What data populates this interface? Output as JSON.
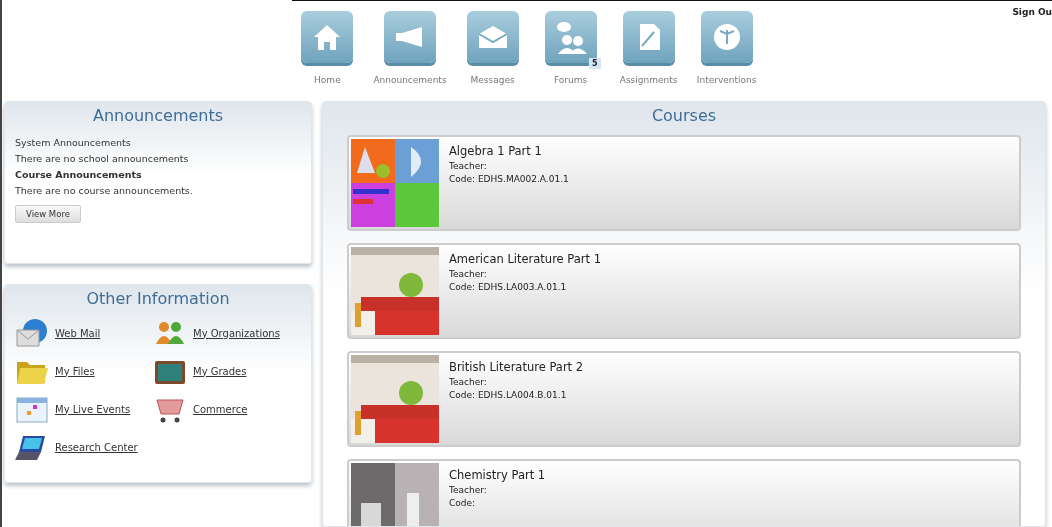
{
  "header": {
    "sign_out": "Sign Ou",
    "nav": [
      {
        "kind": "home",
        "label": "Home"
      },
      {
        "kind": "megaphone",
        "label": "Announcements"
      },
      {
        "kind": "envelope",
        "label": "Messages"
      },
      {
        "kind": "people",
        "label": "Forums",
        "badge": "5"
      },
      {
        "kind": "document",
        "label": "Assignments"
      },
      {
        "kind": "gauge",
        "label": "Interventions"
      }
    ]
  },
  "announcements": {
    "title": "Announcements",
    "lines": [
      {
        "kind": "plain",
        "text": "System Announcements"
      },
      {
        "kind": "plain",
        "text": "There are no school announcements"
      },
      {
        "kind": "heading",
        "text": "Course Announcements"
      },
      {
        "kind": "plain",
        "text": "There are no course announcements."
      }
    ],
    "button": "View More"
  },
  "other_information": {
    "title": "Other Information",
    "links": [
      {
        "kind": "mail",
        "label": "Web Mail"
      },
      {
        "kind": "group",
        "label": "My Organizations"
      },
      {
        "kind": "folder",
        "label": "My Files"
      },
      {
        "kind": "chalkboard",
        "label": "My Grades"
      },
      {
        "kind": "calendar",
        "label": "My Live Events"
      },
      {
        "kind": "cart",
        "label": "Commerce"
      },
      {
        "kind": "laptop",
        "label": "Research Center"
      }
    ]
  },
  "courses": {
    "title": "Courses",
    "items": [
      {
        "kind": "math",
        "name": "Algebra 1 Part 1",
        "teacher": "Teacher:",
        "code": "Code: EDHS.MA002.A.01.1"
      },
      {
        "kind": "books",
        "name": "American Literature Part 1",
        "teacher": "Teacher:",
        "code": "Code: EDHS.LA003.A.01.1"
      },
      {
        "kind": "books",
        "name": "British Literature Part 2",
        "teacher": "Teacher:",
        "code": "Code: EDHS.LA004.B.01.1"
      },
      {
        "kind": "lab",
        "name": "Chemistry Part 1",
        "teacher": "Teacher:",
        "code": "Code:"
      }
    ]
  }
}
